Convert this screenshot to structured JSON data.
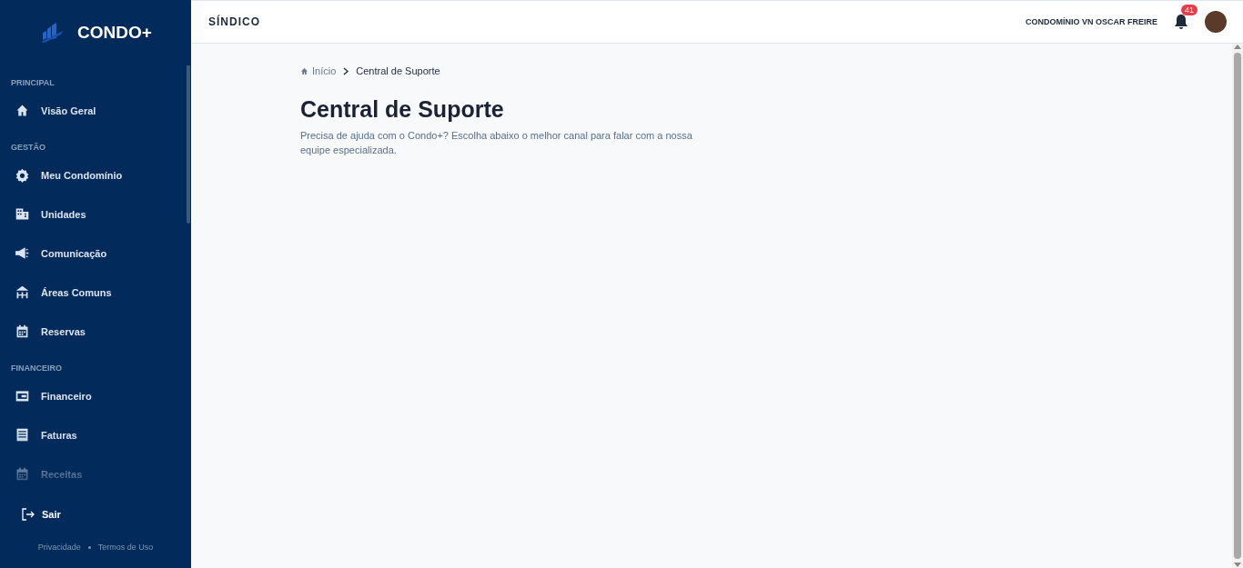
{
  "sidebar": {
    "logo": "CONDO+",
    "sections": [
      {
        "title": "PRINCIPAL",
        "items": [
          {
            "label": "Visão Geral",
            "selected": false
          }
        ]
      },
      {
        "title": "GESTÃO",
        "items": [
          {
            "label": "Meu Condomínio",
            "selected": false
          },
          {
            "label": "Unidades",
            "selected": false
          },
          {
            "label": "Comunicação",
            "selected": false
          },
          {
            "label": "Áreas Comuns",
            "selected": false
          },
          {
            "label": "Reservas",
            "selected": false
          }
        ]
      },
      {
        "title": "FINANCEIRO",
        "items": [
          {
            "label": "Financeiro",
            "selected": false
          },
          {
            "label": "Faturas",
            "selected": false
          },
          {
            "label": "Receitas",
            "selected": false
          }
        ]
      }
    ],
    "logout": "Sair",
    "footer_links": [
      "Privacidade",
      "Termos de Uso"
    ]
  },
  "header": {
    "role": "SÍNDICO",
    "condominium": "CONDOMÍNIO VN OSCAR FREIRE",
    "notifications": "41"
  },
  "breadcrumb": [
    "Início",
    "Central de Suporte"
  ],
  "page": {
    "title": "Central de Suporte",
    "subtitle": "Precisa de ajuda com o Condo+? Escolha abaixo o melhor canal para falar com a nossa equipe especializada."
  }
}
